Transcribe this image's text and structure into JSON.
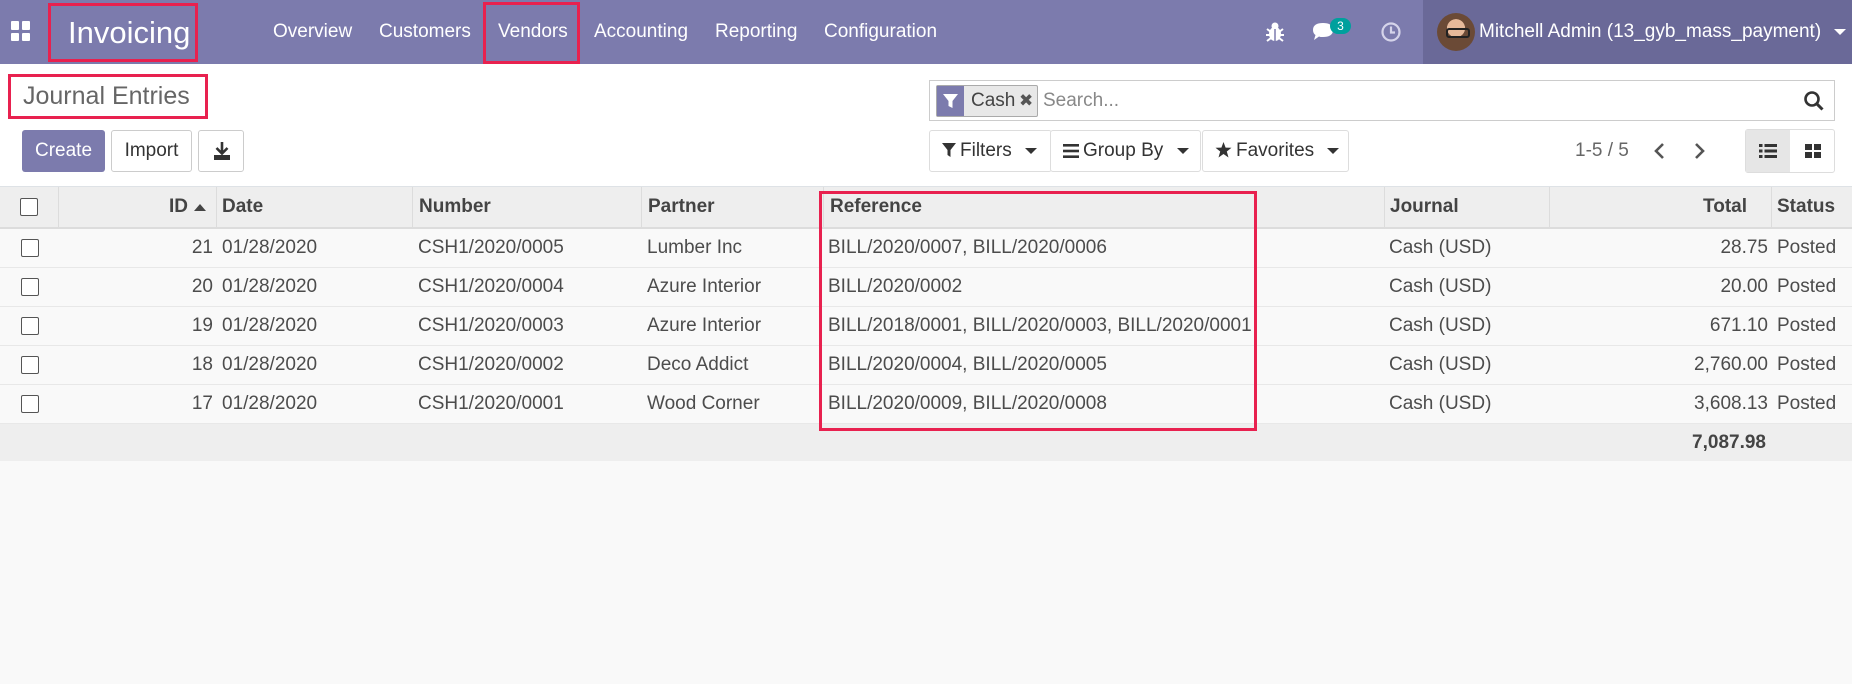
{
  "navbar": {
    "app_name": "Invoicing",
    "menu": [
      "Overview",
      "Customers",
      "Vendors",
      "Accounting",
      "Reporting",
      "Configuration"
    ],
    "icons": [
      "apps-grid-icon",
      "bug-icon",
      "chat-icon",
      "clock-icon"
    ],
    "messages_count": "3",
    "user_name": "Mitchell Admin (13_gyb_mass_payment)"
  },
  "control_panel": {
    "title": "Journal Entries",
    "create_label": "Create",
    "import_label": "Import",
    "search": {
      "facet_label": "Cash",
      "placeholder": "Search..."
    },
    "filters_label": "Filters",
    "group_by_label": "Group By",
    "favorites_label": "Favorites",
    "pager": "1-5 / 5"
  },
  "table": {
    "columns": {
      "id": "ID",
      "date": "Date",
      "number": "Number",
      "partner": "Partner",
      "reference": "Reference",
      "journal": "Journal",
      "total": "Total",
      "status": "Status"
    },
    "rows": [
      {
        "id": "21",
        "date": "01/28/2020",
        "number": "CSH1/2020/0005",
        "partner": "Lumber Inc",
        "reference": "BILL/2020/0007, BILL/2020/0006",
        "journal": "Cash (USD)",
        "total": "28.75",
        "status": "Posted"
      },
      {
        "id": "20",
        "date": "01/28/2020",
        "number": "CSH1/2020/0004",
        "partner": "Azure Interior",
        "reference": "BILL/2020/0002",
        "journal": "Cash (USD)",
        "total": "20.00",
        "status": "Posted"
      },
      {
        "id": "19",
        "date": "01/28/2020",
        "number": "CSH1/2020/0003",
        "partner": "Azure Interior",
        "reference": "BILL/2018/0001, BILL/2020/0003, BILL/2020/0001",
        "journal": "Cash (USD)",
        "total": "671.10",
        "status": "Posted"
      },
      {
        "id": "18",
        "date": "01/28/2020",
        "number": "CSH1/2020/0002",
        "partner": "Deco Addict",
        "reference": "BILL/2020/0004, BILL/2020/0005",
        "journal": "Cash (USD)",
        "total": "2,760.00",
        "status": "Posted"
      },
      {
        "id": "17",
        "date": "01/28/2020",
        "number": "CSH1/2020/0001",
        "partner": "Wood Corner",
        "reference": "BILL/2020/0009, BILL/2020/0008",
        "journal": "Cash (USD)",
        "total": "3,608.13",
        "status": "Posted"
      }
    ],
    "grand_total": "7,087.98"
  },
  "colors": {
    "navbar": "#7c7bad",
    "user_area": "#6a6998",
    "highlight": "#e8214f",
    "badge": "#00a09d"
  }
}
